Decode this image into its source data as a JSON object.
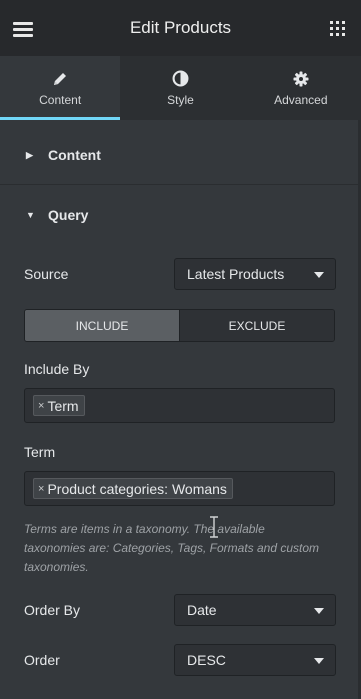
{
  "header": {
    "title": "Edit Products",
    "menu_icon": "hamburger-menu-icon",
    "apps_icon": "grid-apps-icon"
  },
  "tabs": [
    {
      "label": "Content",
      "icon": "pencil-icon",
      "active": true
    },
    {
      "label": "Style",
      "icon": "half-circle-contrast-icon",
      "active": false
    },
    {
      "label": "Advanced",
      "icon": "gear-icon",
      "active": false
    }
  ],
  "sections": {
    "content": {
      "label": "Content",
      "expanded": false
    },
    "query": {
      "label": "Query",
      "expanded": true
    }
  },
  "query": {
    "source": {
      "label": "Source",
      "value": "Latest Products"
    },
    "include_switch": {
      "include_label": "INCLUDE",
      "exclude_label": "EXCLUDE",
      "selected": "INCLUDE"
    },
    "include_by": {
      "label": "Include By",
      "tags": [
        "Term"
      ]
    },
    "term": {
      "label": "Term",
      "tags": [
        "Product categories: Womans"
      ]
    },
    "help_text": "Terms are items in a taxonomy. The available taxonomies are: Categories, Tags, Formats and custom taxonomies.",
    "order_by": {
      "label": "Order By",
      "value": "Date"
    },
    "order": {
      "label": "Order",
      "value": "DESC"
    }
  },
  "colors": {
    "accent": "#71d7f7",
    "panel_bg": "#34383c",
    "header_bg": "#27292c"
  }
}
